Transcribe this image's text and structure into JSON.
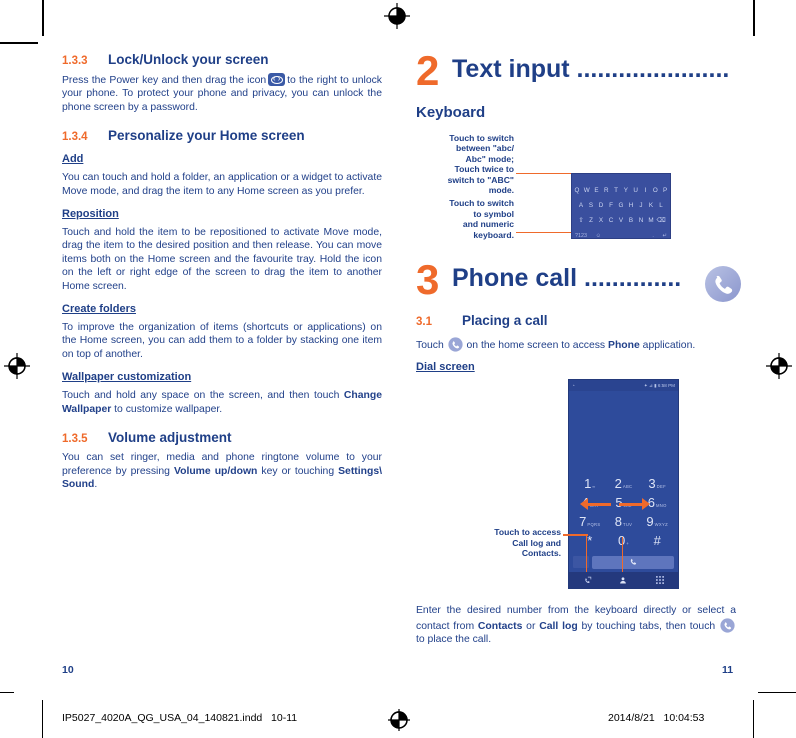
{
  "meta": {
    "accent_orange": "#ef6a2b",
    "accent_blue": "#1f3f87",
    "body_blue": "#22418a"
  },
  "left_column": {
    "section_133": {
      "number": "1.3.3",
      "title": "Lock/Unlock your screen",
      "body_before_icon": "Press the Power key and then drag the icon",
      "body_after_icon": "to the right to unlock your phone.  To protect your phone and privacy, you can unlock the phone screen by a password.",
      "icon_name": "slider-unlock-icon"
    },
    "section_134": {
      "number": "1.3.4",
      "title": "Personalize your Home screen",
      "blocks": [
        {
          "heading": "Add",
          "text": "You can touch and hold a folder, an application or a widget to activate Move mode, and drag the item to any Home screen as you prefer."
        },
        {
          "heading": "Reposition",
          "text": "Touch and hold the item to be repositioned to activate Move mode, drag the item to the desired position and then release. You can move items both on the Home screen and the favourite tray. Hold the icon on the left or right edge of the screen to drag the item to another Home screen."
        },
        {
          "heading": "Create folders",
          "text": "To improve the organization of items (shortcuts or applications) on the Home screen, you can add them to a folder by stacking one item on top of another."
        },
        {
          "heading": "Wallpaper customization",
          "text_1": "Touch and hold any space on the screen, and then touch ",
          "bold_1": "Change Wallpaper",
          "text_2": " to customize wallpaper."
        }
      ]
    },
    "section_135": {
      "number": "1.3.5",
      "title": "Volume adjustment",
      "text_1": "You can set ringer, media and phone ringtone volume to your preference by pressing ",
      "bold_1": "Volume up/down",
      "text_2": " key or touching ",
      "bold_2": "Settings\\ Sound",
      "text_3": "."
    },
    "page_number": "10"
  },
  "right_column": {
    "chapter_2": {
      "number": "2",
      "title": "Text input",
      "dots": "......................"
    },
    "keyboard": {
      "heading": "Keyboard",
      "callout_1": "Touch to switch between \"abc/ Abc\" mode; Touch twice to switch to \"ABC\" mode.",
      "callout_1_lines": [
        "Touch to switch",
        "between \"abc/",
        "Abc\" mode;",
        "Touch twice to",
        "switch to \"ABC\"",
        "mode."
      ],
      "callout_2_lines": [
        "Touch to switch",
        "to symbol",
        "and numeric",
        "keyboard."
      ],
      "rows": [
        [
          "Q",
          "W",
          "E",
          "R",
          "T",
          "Y",
          "U",
          "I",
          "O",
          "P"
        ],
        [
          "A",
          "S",
          "D",
          "F",
          "G",
          "H",
          "J",
          "K",
          "L"
        ],
        [
          "⇧",
          "Z",
          "X",
          "C",
          "V",
          "B",
          "N",
          "M",
          "⌫"
        ]
      ],
      "bottom_row": {
        "symbols_key": "?123",
        "emoji_key": "☺",
        "period_key": ".",
        "enter_key": "↵"
      }
    },
    "chapter_3": {
      "number": "3",
      "title": "Phone call",
      "dots": "..............",
      "icon_name": "phone-handset-icon"
    },
    "section_31": {
      "number": "3.1",
      "title": "Placing a call",
      "text_1": "Touch ",
      "text_2": " on the home screen to access ",
      "bold_1": "Phone",
      "text_3": " application."
    },
    "dial_screen": {
      "heading": "Dial screen",
      "status_left": "◔",
      "status_right": "✦ ⊿ ▮ 6:58 PM",
      "keys": [
        {
          "digit": "1",
          "sub": "∞"
        },
        {
          "digit": "2",
          "sub": "ABC"
        },
        {
          "digit": "3",
          "sub": "DEF"
        },
        {
          "digit": "4",
          "sub": "GHI"
        },
        {
          "digit": "5",
          "sub": "JKL"
        },
        {
          "digit": "6",
          "sub": "MNO"
        },
        {
          "digit": "7",
          "sub": "PQRS"
        },
        {
          "digit": "8",
          "sub": "TUV"
        },
        {
          "digit": "9",
          "sub": "WXYZ"
        },
        {
          "digit": "*",
          "sub": ""
        },
        {
          "digit": "0",
          "sub": "+"
        },
        {
          "digit": "#",
          "sub": ""
        }
      ],
      "tabs": [
        {
          "name": "call-log-tab",
          "glyph": "✆"
        },
        {
          "name": "contacts-tab",
          "glyph": "👤"
        },
        {
          "name": "dialpad-tab",
          "glyph": "⣿"
        }
      ],
      "callout_lines": [
        "Touch to access",
        "Call log and",
        "Contacts."
      ],
      "callout_bold": [
        "Call log",
        "Contacts"
      ]
    },
    "closing_paragraph": {
      "text_1": "Enter the desired number from the keyboard directly or select a contact from ",
      "bold_1": "Contacts",
      "text_2": " or ",
      "bold_2": "Call log",
      "text_3": " by touching tabs, then touch ",
      "text_4": " to place the call."
    },
    "page_number": "11"
  },
  "footer": {
    "filename": "IP5027_4020A_QG_USA_04_140821.indd",
    "pages": "10-11",
    "timestamp_date": "2014/8/21",
    "timestamp_time": "10:04:53"
  }
}
